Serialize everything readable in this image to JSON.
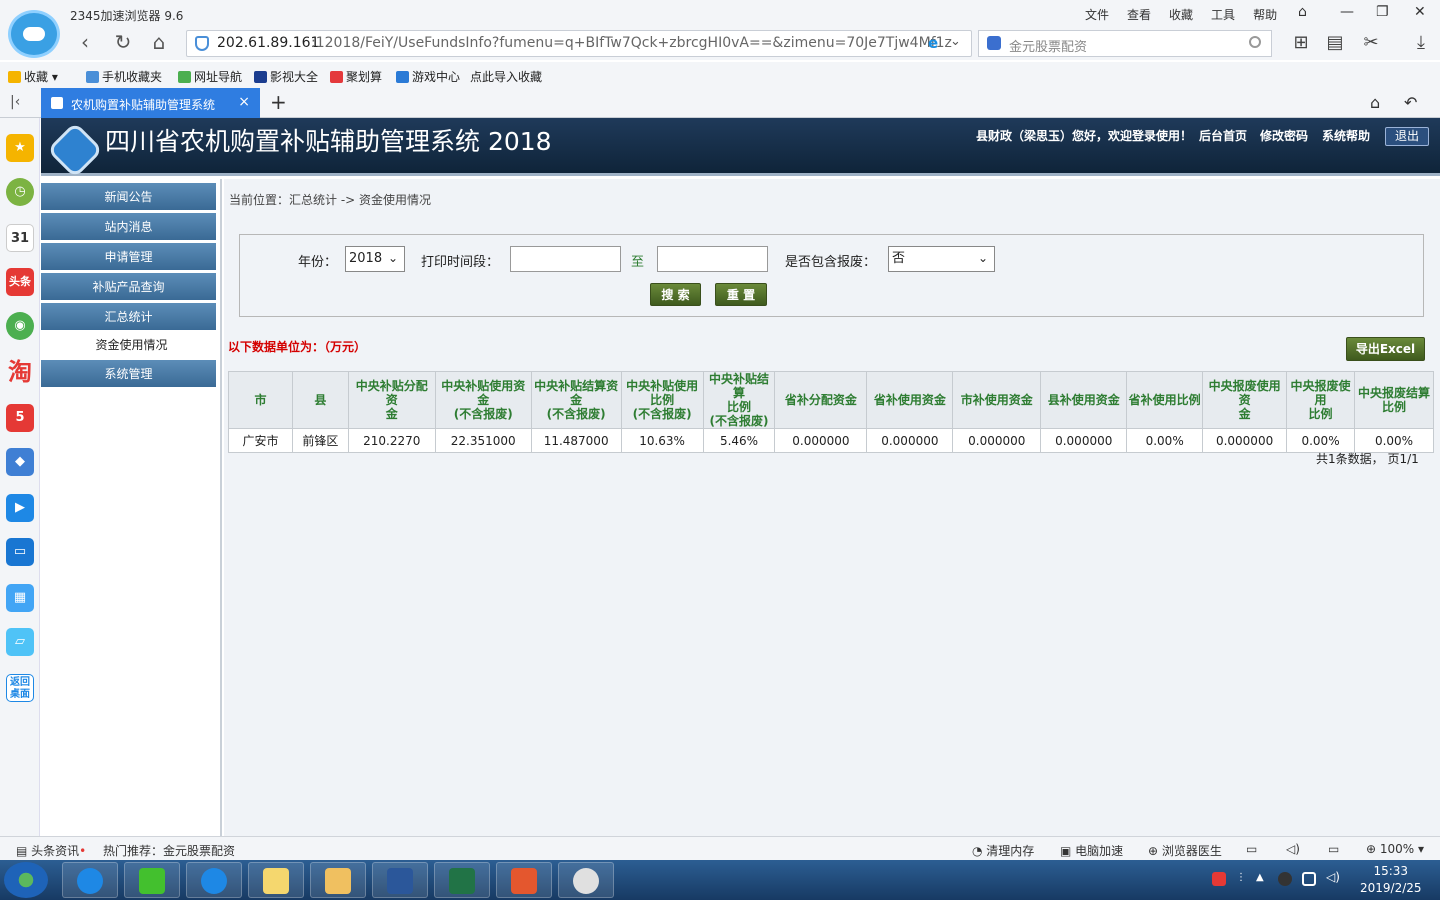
{
  "browser": {
    "name": "2345加速浏览器 9.6",
    "menu": [
      "文件",
      "查看",
      "收藏",
      "工具",
      "帮助"
    ],
    "address_host": "202.61.89.161",
    "address_path": ":12018/FeiY/UseFundsInfo?fumenu=q+BIfTw7Qck+zbrcgHI0vA==&zimenu=70Je7Tjw4Mf1z",
    "search_placeholder": "金元股票配资",
    "bookmarks": [
      "收藏",
      "手机收藏夹",
      "网址导航",
      "影视大全",
      "聚划算",
      "游戏中心",
      "点此导入收藏"
    ],
    "tab_title": "农机购置补贴辅助管理系统"
  },
  "app": {
    "title": "四川省农机购置补贴辅助管理系统 2018",
    "user_greeting": "县财政（梁思玉）您好，欢迎登录使用！",
    "links": [
      "后台首页",
      "修改密码",
      "系统帮助"
    ],
    "logout": "退出"
  },
  "menu": {
    "items": [
      "新闻公告",
      "站内消息",
      "申请管理",
      "补贴产品查询",
      "汇总统计"
    ],
    "sub_active": "资金使用情况",
    "last": "系统管理"
  },
  "content": {
    "breadcrumb": "当前位置：汇总统计 -> 资金使用情况",
    "filter": {
      "year_label": "年份：",
      "year_value": "2018",
      "print_label": "打印时间段：",
      "to_label": "至",
      "scrap_label": "是否包含报废：",
      "scrap_value": "否",
      "search_btn": "搜 索",
      "reset_btn": "重 置"
    },
    "unit_note": "以下数据单位为：（万元）",
    "export_btn": "导出Excel",
    "table": {
      "headers": [
        [
          "市"
        ],
        [
          "县"
        ],
        [
          "中央补贴分配资",
          "金"
        ],
        [
          "中央补贴使用资",
          "金",
          "(不含报废)"
        ],
        [
          "中央补贴结算资",
          "金",
          "(不含报废)"
        ],
        [
          "中央补贴使用",
          "比例",
          "(不含报废)"
        ],
        [
          "中央补贴结算",
          "比例",
          "(不含报废)"
        ],
        [
          "省补分配资金"
        ],
        [
          "省补使用资金"
        ],
        [
          "市补使用资金"
        ],
        [
          "县补使用资金"
        ],
        [
          "省补使用比例"
        ],
        [
          "中央报废使用资",
          "金"
        ],
        [
          "中央报废使用",
          "比例"
        ],
        [
          "中央报废结算",
          "比例"
        ]
      ],
      "rows": [
        [
          "广安市",
          "前锋区",
          "210.2270",
          "22.351000",
          "11.487000",
          "10.63%",
          "5.46%",
          "0.000000",
          "0.000000",
          "0.000000",
          "0.000000",
          "0.00%",
          "0.000000",
          "0.00%",
          "0.00%"
        ]
      ]
    },
    "pager": "共1条数据， 页1/1"
  },
  "statusbar": {
    "news": "头条资讯",
    "recommend": "热门推荐：金元股票配资",
    "clean_mem": "清理内存",
    "speedup": "电脑加速",
    "doctor": "浏览器医生",
    "zoom": "100%"
  },
  "taskbar": {
    "time": "15:33",
    "date": "2019/2/25"
  },
  "colors": {
    "header_bg": "#1f3a5a",
    "menu_bg": "#4a7ca8",
    "button_green": "#4f6e28",
    "table_header_text": "#2e7d32",
    "unit_note": "#d40000",
    "tab_blue": "#2f7de1"
  }
}
